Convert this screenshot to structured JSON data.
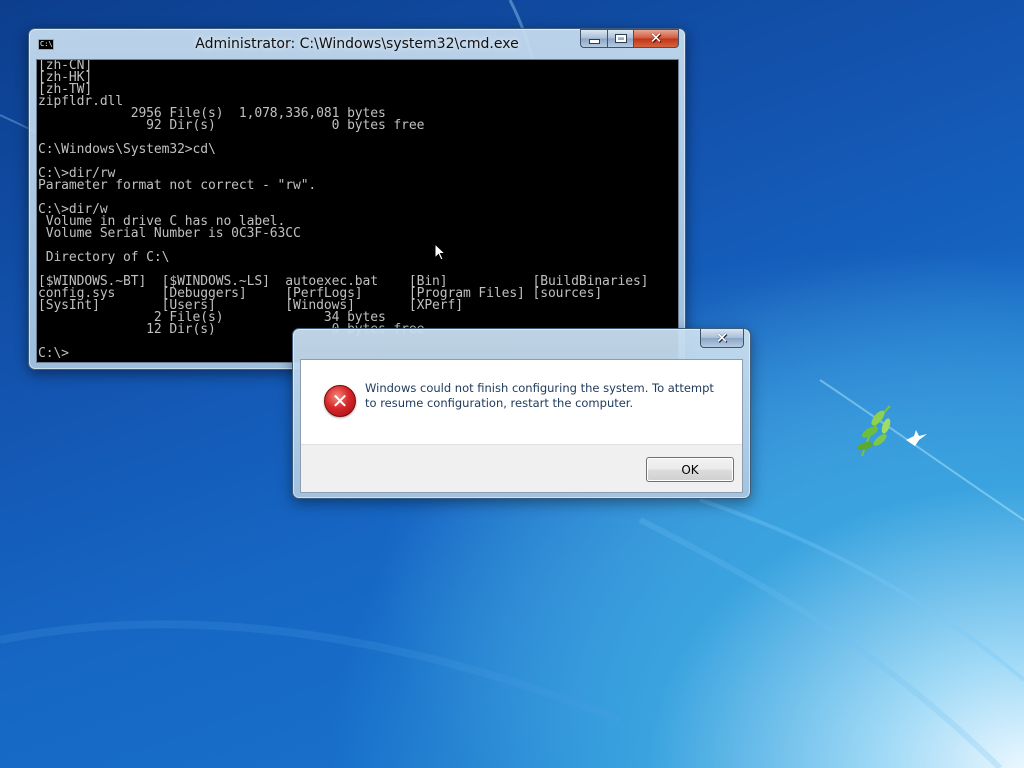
{
  "cmd_window": {
    "title": "Administrator: C:\\Windows\\system32\\cmd.exe",
    "icon_label": "C:\\",
    "icon_name": "console-app-icon",
    "close_glyph": "✕",
    "console_lines": [
      "[zh-CN]",
      "[zh-HK]",
      "[zh-TW]",
      "zipfldr.dll",
      "            2956 File(s)  1,078,336,081 bytes",
      "              92 Dir(s)               0 bytes free",
      "",
      "C:\\Windows\\System32>cd\\",
      "",
      "C:\\>dir/rw",
      "Parameter format not correct - \"rw\".",
      "",
      "C:\\>dir/w",
      " Volume in drive C has no label.",
      " Volume Serial Number is 0C3F-63CC",
      "",
      " Directory of C:\\",
      "",
      "[$WINDOWS.~BT]  [$WINDOWS.~LS]  autoexec.bat    [Bin]           [BuildBinaries]",
      "config.sys      [Debuggers]     [PerfLogs]      [Program Files] [sources]",
      "[SysInt]        [Users]         [Windows]       [XPerf]",
      "               2 File(s)             34 bytes",
      "              12 Dir(s)               0 bytes free",
      "",
      "C:\\>"
    ]
  },
  "error_dialog": {
    "message": "Windows could not finish configuring the system. To attempt to resume configuration, restart the computer.",
    "ok_label": "OK",
    "icon_glyph": "✕",
    "close_glyph": "✕",
    "icon_name": "error-icon"
  },
  "colors": {
    "console_bg": "#000000",
    "console_fg": "#c0c0c0",
    "desktop_blue": "#1667c4",
    "error_red": "#d7272a"
  }
}
